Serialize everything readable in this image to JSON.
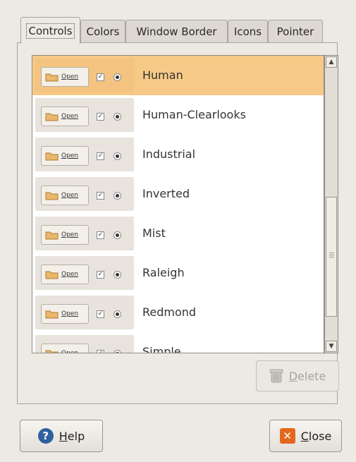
{
  "tabs": [
    "Controls",
    "Colors",
    "Window Border",
    "Icons",
    "Pointer"
  ],
  "active_tab": "Controls",
  "preview_button_label": "Open",
  "themes": [
    {
      "name": "Human",
      "selected": true
    },
    {
      "name": "Human-Clearlooks",
      "selected": false
    },
    {
      "name": "Industrial",
      "selected": false
    },
    {
      "name": "Inverted",
      "selected": false
    },
    {
      "name": "Mist",
      "selected": false
    },
    {
      "name": "Raleigh",
      "selected": false
    },
    {
      "name": "Redmond",
      "selected": false
    },
    {
      "name": "Simple",
      "selected": false
    }
  ],
  "buttons": {
    "delete": {
      "mnemonic": "D",
      "rest": "elete"
    },
    "help": {
      "mnemonic": "H",
      "rest": "elp"
    },
    "close": {
      "mnemonic": "C",
      "rest": "lose"
    }
  },
  "colors": {
    "selection": "#f7c987",
    "help_icon": "#2f5fa0",
    "close_icon": "#e3681e"
  },
  "icons": {
    "help": "help-icon",
    "close": "close-icon",
    "delete": "trash-icon",
    "preview": "folder-icon"
  }
}
